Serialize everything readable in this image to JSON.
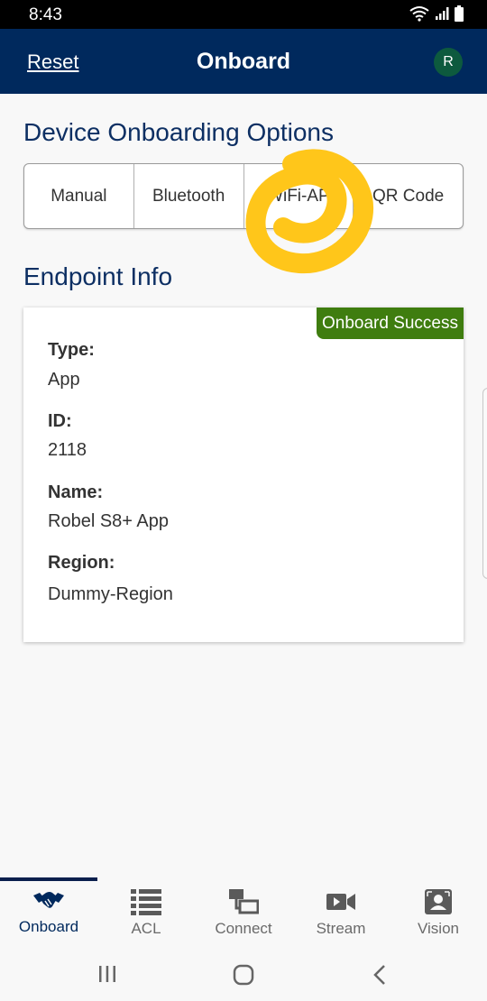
{
  "status_bar": {
    "time": "8:43"
  },
  "header": {
    "reset_label": "Reset",
    "title": "Onboard",
    "avatar_initial": "R"
  },
  "onboarding": {
    "title": "Device Onboarding Options",
    "options": [
      "Manual",
      "Bluetooth",
      "WiFi-AP",
      "QR Code"
    ]
  },
  "endpoint": {
    "title": "Endpoint Info",
    "status": "Onboard Success",
    "fields": [
      {
        "label": "Type:",
        "value": "App"
      },
      {
        "label": "ID:",
        "value": "2118"
      },
      {
        "label": "Name:",
        "value": "Robel S8+ App"
      },
      {
        "label": "Region:",
        "value": "Dummy-Region"
      }
    ]
  },
  "tabs": [
    {
      "label": "Onboard",
      "icon": "handshake-icon",
      "active": true
    },
    {
      "label": "ACL",
      "icon": "list-icon",
      "active": false
    },
    {
      "label": "Connect",
      "icon": "network-icon",
      "active": false
    },
    {
      "label": "Stream",
      "icon": "video-camera-icon",
      "active": false
    },
    {
      "label": "Vision",
      "icon": "face-scan-icon",
      "active": false
    }
  ],
  "colors": {
    "header": "#00295d",
    "success": "#3f7d0f",
    "highlight": "#ffc61a"
  }
}
